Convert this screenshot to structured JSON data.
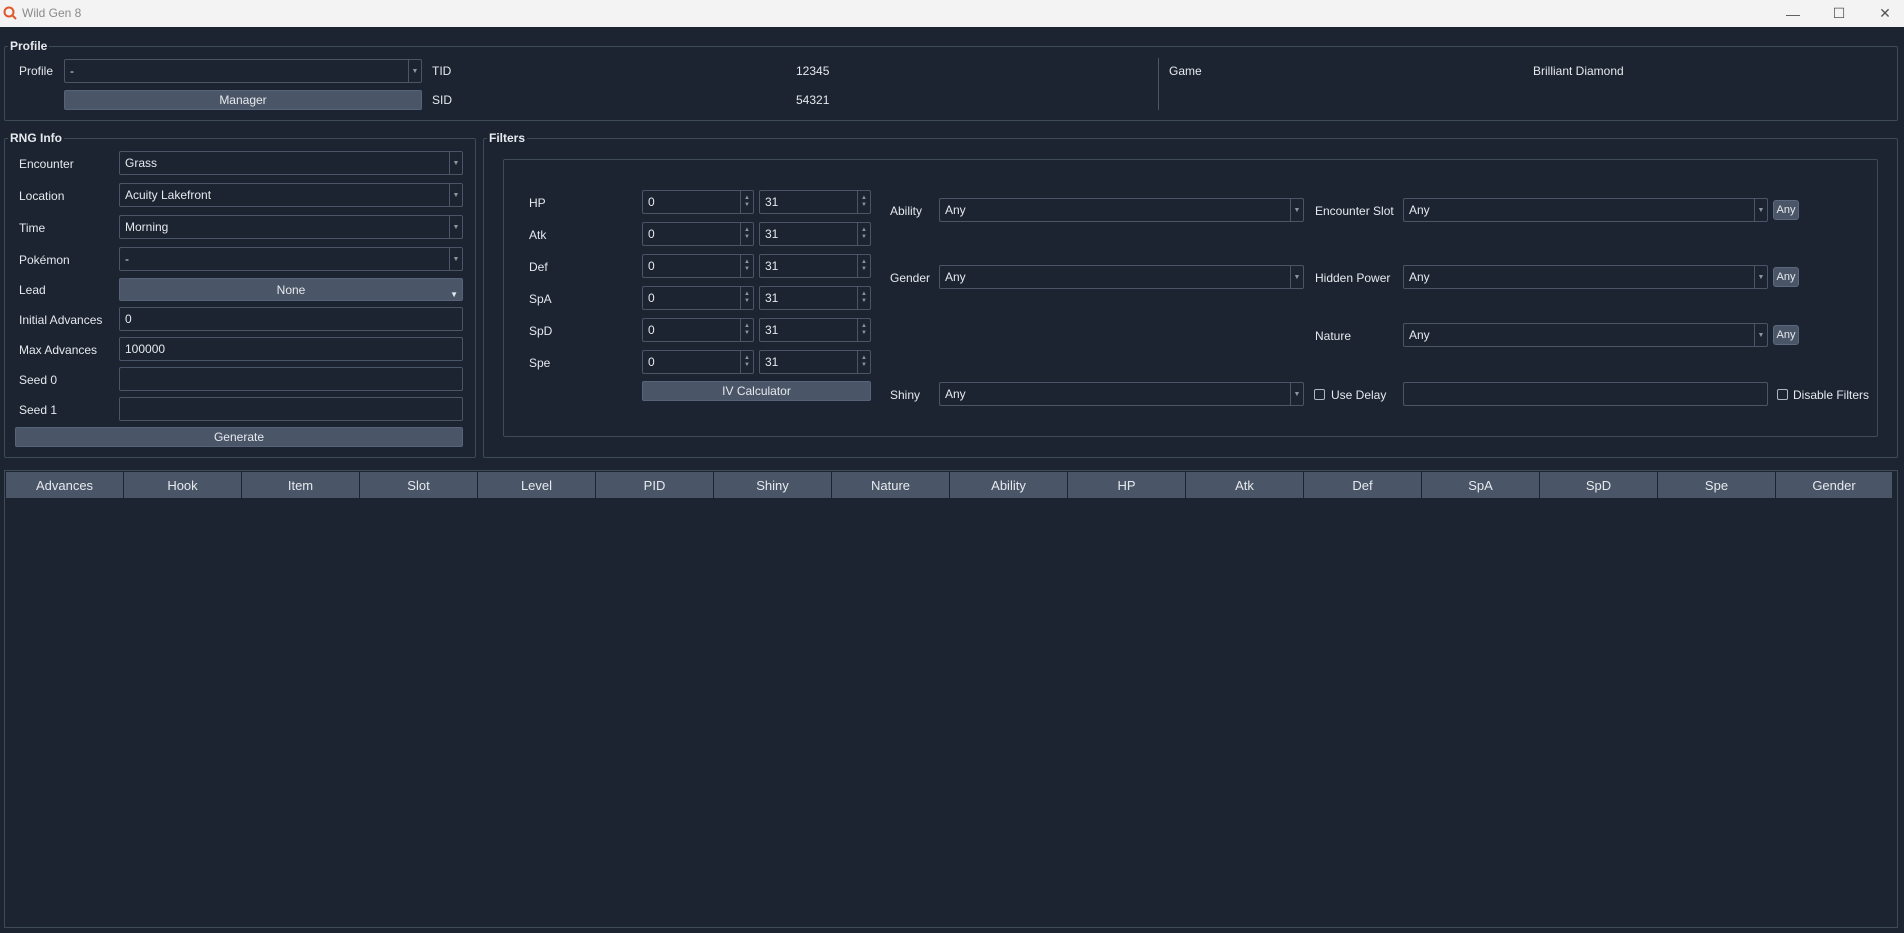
{
  "window": {
    "title": "Wild Gen 8",
    "minimize_glyph": "—",
    "maximize_glyph": "☐",
    "close_glyph": "✕"
  },
  "profile": {
    "group_title": "Profile",
    "profile_label": "Profile",
    "profile_value": "-",
    "manager_button": "Manager",
    "tid_label": "TID",
    "tid_value": "12345",
    "sid_label": "SID",
    "sid_value": "54321",
    "game_label": "Game",
    "game_value": "Brilliant Diamond"
  },
  "rng": {
    "group_title": "RNG Info",
    "encounter_label": "Encounter",
    "encounter_value": "Grass",
    "location_label": "Location",
    "location_value": "Acuity Lakefront",
    "time_label": "Time",
    "time_value": "Morning",
    "pokemon_label": "Pokémon",
    "pokemon_value": "-",
    "lead_label": "Lead",
    "lead_value": "None",
    "initial_label": "Initial Advances",
    "initial_value": "0",
    "max_label": "Max Advances",
    "max_value": "100000",
    "seed0_label": "Seed 0",
    "seed0_value": "",
    "seed1_label": "Seed 1",
    "seed1_value": "",
    "generate_button": "Generate"
  },
  "filters": {
    "group_title": "Filters",
    "ivs": [
      {
        "stat": "HP",
        "min": "0",
        "max": "31"
      },
      {
        "stat": "Atk",
        "min": "0",
        "max": "31"
      },
      {
        "stat": "Def",
        "min": "0",
        "max": "31"
      },
      {
        "stat": "SpA",
        "min": "0",
        "max": "31"
      },
      {
        "stat": "SpD",
        "min": "0",
        "max": "31"
      },
      {
        "stat": "Spe",
        "min": "0",
        "max": "31"
      }
    ],
    "iv_calculator_button": "IV Calculator",
    "ability_label": "Ability",
    "ability_value": "Any",
    "gender_label": "Gender",
    "gender_value": "Any",
    "shiny_label": "Shiny",
    "shiny_value": "Any",
    "encounter_slot_label": "Encounter Slot",
    "encounter_slot_value": "Any",
    "hidden_power_label": "Hidden Power",
    "hidden_power_value": "Any",
    "nature_label": "Nature",
    "nature_value": "Any",
    "any_button": "Any",
    "use_delay_label": "Use Delay",
    "use_delay_checked": false,
    "delay_value": "",
    "disable_filters_label": "Disable Filters",
    "disable_filters_checked": false
  },
  "table": {
    "columns": [
      "Advances",
      "Hook",
      "Item",
      "Slot",
      "Level",
      "PID",
      "Shiny",
      "Nature",
      "Ability",
      "HP",
      "Atk",
      "Def",
      "SpA",
      "SpD",
      "Spe",
      "Gender"
    ],
    "rows": []
  }
}
